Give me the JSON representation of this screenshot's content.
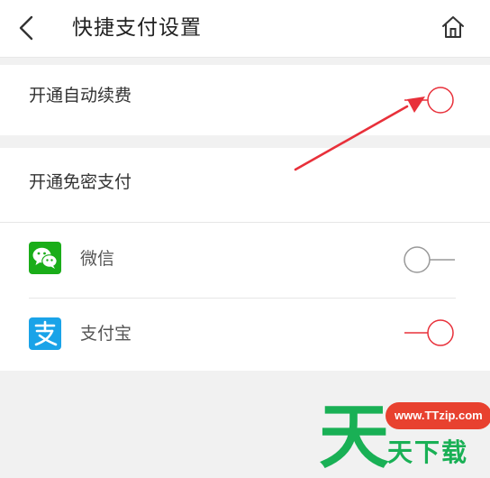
{
  "header": {
    "title": "快捷支付设置",
    "back_icon": "chevron-left-icon",
    "home_icon": "home-icon"
  },
  "auto_renew": {
    "label": "开通自动续费",
    "enabled": false
  },
  "password_free": {
    "section_label": "开通免密支付",
    "items": [
      {
        "label": "微信",
        "icon": "wechat-icon",
        "enabled": false
      },
      {
        "label": "支付宝",
        "icon": "alipay-icon",
        "enabled": true
      }
    ]
  },
  "annotation": {
    "arrow_color": "#e8303a"
  },
  "colors": {
    "accent": "#e8303a",
    "wechat": "#1aad19",
    "alipay": "#1aa3e8",
    "toggle_off": "#999999"
  },
  "watermark": {
    "url": "www.TTzip.com",
    "big_char": "天",
    "text": "天下载"
  }
}
